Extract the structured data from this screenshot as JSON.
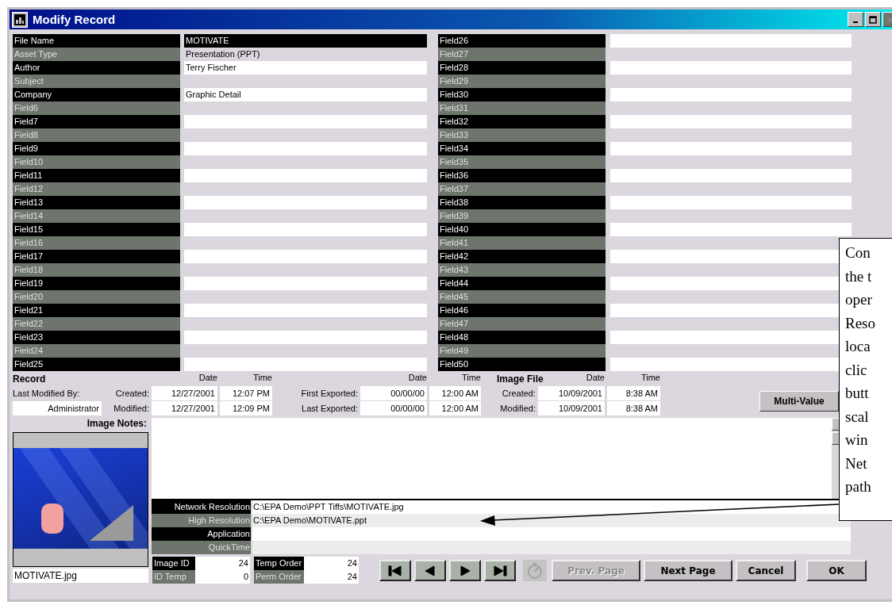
{
  "window": {
    "title": "Modify Record"
  },
  "fields_left": [
    {
      "label": "File Name",
      "value": "MOTIVATE",
      "selected": true
    },
    {
      "label": "Asset Type",
      "value": "Presentation (PPT)",
      "selected": false
    },
    {
      "label": "Author",
      "value": "Terry Fischer",
      "selected": false
    },
    {
      "label": "Subject",
      "selected": false
    },
    {
      "label": "Company",
      "value": "Graphic Detail",
      "selected": false
    },
    {
      "label": "Field6",
      "selected": false
    },
    {
      "label": "Field7",
      "selected": false
    },
    {
      "label": "Field8",
      "selected": false
    },
    {
      "label": "Field9",
      "selected": false
    },
    {
      "label": "Field10",
      "selected": false
    },
    {
      "label": "Field11",
      "selected": false
    },
    {
      "label": "Field12",
      "selected": false
    },
    {
      "label": "Field13",
      "selected": false
    },
    {
      "label": "Field14",
      "selected": false
    },
    {
      "label": "Field15",
      "selected": false
    },
    {
      "label": "Field16",
      "selected": false
    },
    {
      "label": "Field17",
      "selected": false
    },
    {
      "label": "Field18",
      "selected": false
    },
    {
      "label": "Field19",
      "selected": false
    },
    {
      "label": "Field20",
      "selected": false
    },
    {
      "label": "Field21",
      "selected": false
    },
    {
      "label": "Field22",
      "selected": false
    },
    {
      "label": "Field23",
      "selected": false
    },
    {
      "label": "Field24",
      "selected": false
    },
    {
      "label": "Field25",
      "selected": false
    }
  ],
  "fields_right": [
    {
      "label": "Field26",
      "selected": false
    },
    {
      "label": "Field27",
      "selected": false
    },
    {
      "label": "Field28",
      "selected": false
    },
    {
      "label": "Field29",
      "selected": false
    },
    {
      "label": "Field30",
      "selected": false
    },
    {
      "label": "Field31",
      "selected": false
    },
    {
      "label": "Field32",
      "selected": false
    },
    {
      "label": "Field33",
      "selected": false
    },
    {
      "label": "Field34",
      "selected": false
    },
    {
      "label": "Field35",
      "selected": false
    },
    {
      "label": "Field36",
      "selected": false
    },
    {
      "label": "Field37",
      "selected": false
    },
    {
      "label": "Field38",
      "selected": false
    },
    {
      "label": "Field39",
      "selected": false
    },
    {
      "label": "Field40",
      "selected": false
    },
    {
      "label": "Field41",
      "selected": false
    },
    {
      "label": "Field42",
      "selected": false
    },
    {
      "label": "Field43",
      "selected": false
    },
    {
      "label": "Field44",
      "selected": false
    },
    {
      "label": "Field45",
      "selected": false
    },
    {
      "label": "Field46",
      "selected": false
    },
    {
      "label": "Field47",
      "selected": false
    },
    {
      "label": "Field48",
      "selected": false
    },
    {
      "label": "Field49",
      "selected": false
    },
    {
      "label": "Field50",
      "selected": false
    }
  ],
  "record_info": {
    "record_title": "Record",
    "image_file_title": "Image File",
    "column_headers": [
      "Date",
      "Time",
      "Date",
      "Time",
      "Date",
      "Time"
    ],
    "modified_by_label": "Last Modified By:",
    "modified_by": "Administrator",
    "rows": [
      {
        "label": "Created:",
        "date": "12/27/2001",
        "time": "12:07 PM",
        "export_label": "First Exported:",
        "export_date": "00/00/00",
        "export_time": "12:00 AM",
        "file_label": "Created:",
        "file_date": "10/09/2001",
        "file_time": "8:38 AM"
      },
      {
        "label": "Modified:",
        "date": "12/27/2001",
        "time": "12:09 PM",
        "export_label": "Last Exported:",
        "export_date": "00/00/00",
        "export_time": "12:00 AM",
        "file_label": "Modified:",
        "file_date": "10/09/2001",
        "file_time": "8:38 AM"
      }
    ]
  },
  "multi_value_button": {
    "label": "Multi-Value"
  },
  "image_notes": {
    "label": "Image Notes:"
  },
  "thumbnail": {
    "filename": "MOTIVATE.jpg"
  },
  "resolutions": [
    {
      "label": "Network Resolution",
      "value": "C:\\EPA Demo\\PPT Tiffs\\MOTIVATE.jpg"
    },
    {
      "label": "High Resolution",
      "value": "C:\\EPA Demo\\MOTIVATE.ppt"
    },
    {
      "label": "Application"
    },
    {
      "label": "QuickTime"
    }
  ],
  "ids": [
    {
      "label": "Image ID",
      "value": "24"
    },
    {
      "label": "Temp Order",
      "value": "24"
    },
    {
      "label": "ID Temp",
      "value": "0"
    },
    {
      "label": "Perm Order",
      "value": "24"
    }
  ],
  "nav_buttons": [
    {
      "kind": "first",
      "disabled": false
    },
    {
      "kind": "prev",
      "disabled": false
    },
    {
      "kind": "next",
      "disabled": false
    },
    {
      "kind": "last",
      "disabled": false
    },
    {
      "kind": "timer",
      "disabled": true
    }
  ],
  "buttons": [
    {
      "label": "Prev. Page",
      "disabled": true
    },
    {
      "label": "Next Page",
      "disabled": false
    },
    {
      "label": "Cancel",
      "disabled": false
    },
    {
      "label": "OK",
      "disabled": false
    }
  ],
  "callout": {
    "lines": [
      "Con",
      "the t",
      "oper",
      "Reso",
      "loca",
      "clic",
      "butt",
      "scal",
      "win",
      "Net",
      "path"
    ]
  }
}
